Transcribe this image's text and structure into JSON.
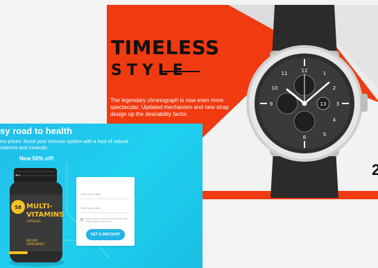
{
  "watch_card": {
    "headline": "TIMELESS",
    "subline": "STYLE",
    "description": "The legendary chronograph is now even more spectacular. Updated mechanism and new strap design up the desirability factor.",
    "edge_glyph": "2",
    "dial": {
      "hour_numbers": [
        "12",
        "11",
        "10",
        "9",
        "1",
        "2",
        "3",
        "4",
        "5",
        "6"
      ],
      "subdial_date": "13"
    },
    "colors": {
      "accent": "#f03a10",
      "background": "#ececec"
    }
  },
  "vitamins_card": {
    "title": "sy road to health",
    "description": "est prices. Boost your immune system with a host of natural vitamins and minerals.",
    "offer": "New 50% off!",
    "carousel_arrow": "←",
    "bottle_label": {
      "badge": "58",
      "brand_line1": "MULTI-",
      "brand_line2": "VITAMINS",
      "sub": "CAPSULES",
      "footer_line1": "DIETARY",
      "footer_line2": "SUPPLEMENT"
    },
    "form": {
      "email_placeholder": "Enter your email",
      "name_placeholder": "Enter your name",
      "consent": "I agree to receive commercial information from Company Name (1 hour here)",
      "cta": "GET A DISCOUNT"
    },
    "colors": {
      "accent": "#21b5e5",
      "gradient_start": "#22bde8"
    }
  }
}
